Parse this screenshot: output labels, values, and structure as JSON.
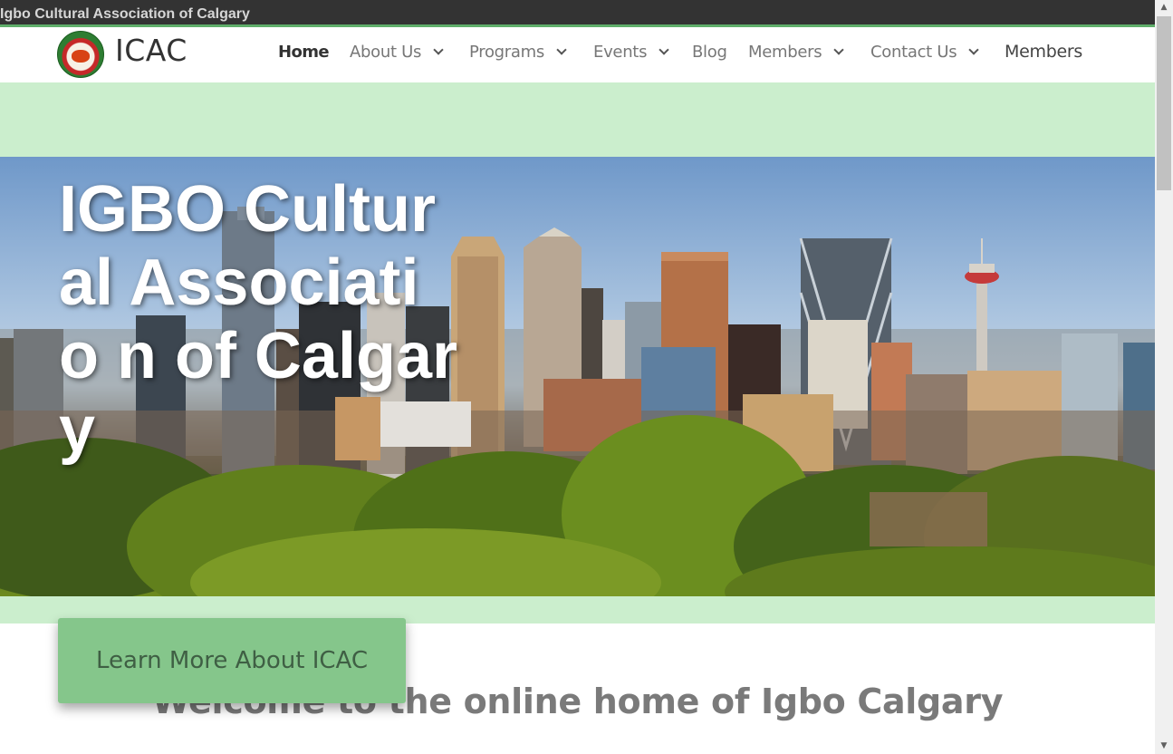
{
  "window": {
    "title": "Igbo Cultural Association of Calgary"
  },
  "header": {
    "brand": "ICAC",
    "nav": [
      {
        "label": "Home",
        "active": true,
        "has_dropdown": false
      },
      {
        "label": "About Us",
        "active": false,
        "has_dropdown": true
      },
      {
        "label": "Programs",
        "active": false,
        "has_dropdown": true
      },
      {
        "label": "Events",
        "active": false,
        "has_dropdown": true
      },
      {
        "label": "Blog",
        "active": false,
        "has_dropdown": false
      },
      {
        "label": "Members",
        "active": false,
        "has_dropdown": true
      },
      {
        "label": "Contact Us",
        "active": false,
        "has_dropdown": true
      },
      {
        "label": "Members",
        "active": false,
        "has_dropdown": false
      }
    ]
  },
  "hero": {
    "title": "IGBO Cultural Associatio n of Calgary"
  },
  "cta": {
    "label": "Learn More About ICAC"
  },
  "welcome": {
    "heading": "Welcome to the online home of Igbo Calgary"
  },
  "colors": {
    "band_green": "#cbeecd",
    "button_green": "#85c68b",
    "titlebar": "#333333"
  }
}
